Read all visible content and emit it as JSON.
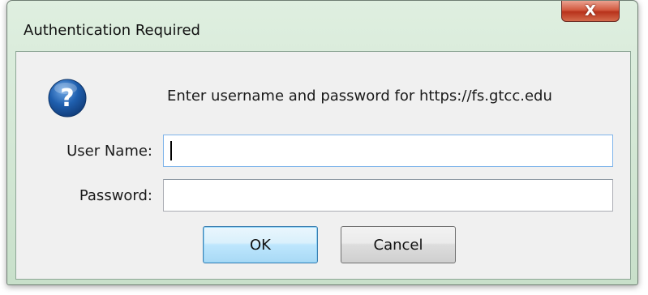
{
  "window": {
    "title": "Authentication Required",
    "close_label": "X"
  },
  "dialog": {
    "prompt": "Enter username and password for https://fs.gtcc.edu",
    "icon": "question-icon",
    "fields": {
      "username_label": "User Name:",
      "username_value": "",
      "password_label": "Password:",
      "password_value": ""
    },
    "buttons": {
      "ok_label": "OK",
      "cancel_label": "Cancel"
    }
  },
  "colors": {
    "titlebar": "#dfefe0",
    "close_button": "#c94a30",
    "ok_button_border": "#3c7fb1",
    "icon_blue": "#1f5fae"
  }
}
